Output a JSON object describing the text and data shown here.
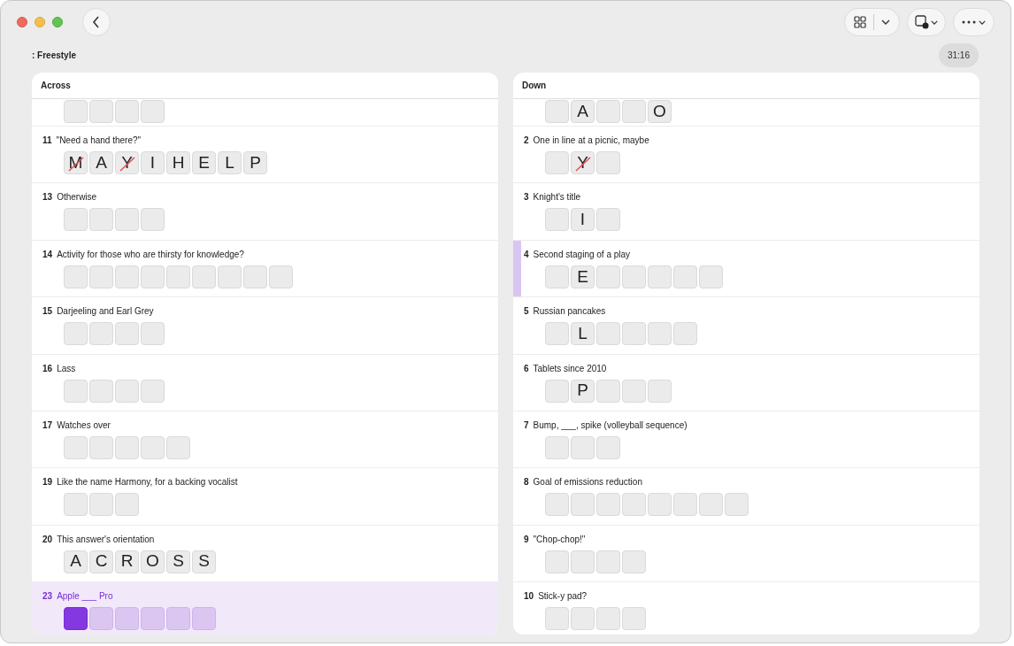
{
  "title": ": Freestyle",
  "timer": "31:16",
  "panels": [
    {
      "heading": "Across",
      "clues": [
        {
          "kind": "partial",
          "active": false,
          "related": false,
          "cells": [
            {
              "selected": false
            },
            {
              "selected": false
            },
            {
              "selected": false
            },
            {
              "selected": false
            }
          ]
        },
        {
          "kind": "full",
          "number": "11",
          "text": "\"Need a hand there?\"",
          "active": false,
          "related": false,
          "cells": [
            {
              "letter": "M",
              "wrong": true,
              "selected": false
            },
            {
              "letter": "A",
              "selected": false
            },
            {
              "letter": "Y",
              "wrong": true,
              "selected": false
            },
            {
              "letter": "I",
              "selected": false
            },
            {
              "letter": "H",
              "selected": false
            },
            {
              "letter": "E",
              "selected": false
            },
            {
              "letter": "L",
              "selected": false
            },
            {
              "letter": "P",
              "selected": false
            }
          ]
        },
        {
          "kind": "full",
          "number": "13",
          "text": "Otherwise",
          "active": false,
          "related": false,
          "cells": [
            {
              "selected": false
            },
            {
              "selected": false
            },
            {
              "selected": false
            },
            {
              "selected": false
            }
          ]
        },
        {
          "kind": "full",
          "number": "14",
          "text": "Activity for those who are thirsty for knowledge?",
          "active": false,
          "related": false,
          "cells": [
            {
              "selected": false
            },
            {
              "selected": false
            },
            {
              "selected": false
            },
            {
              "selected": false
            },
            {
              "selected": false
            },
            {
              "selected": false
            },
            {
              "selected": false
            },
            {
              "selected": false
            },
            {
              "selected": false
            }
          ]
        },
        {
          "kind": "full",
          "number": "15",
          "text": "Darjeeling and Earl Grey",
          "active": false,
          "related": false,
          "cells": [
            {
              "selected": false
            },
            {
              "selected": false
            },
            {
              "selected": false
            },
            {
              "selected": false
            }
          ]
        },
        {
          "kind": "full",
          "number": "16",
          "text": "Lass",
          "active": false,
          "related": false,
          "cells": [
            {
              "selected": false
            },
            {
              "selected": false
            },
            {
              "selected": false
            },
            {
              "selected": false
            }
          ]
        },
        {
          "kind": "full",
          "number": "17",
          "text": "Watches over",
          "active": false,
          "related": false,
          "cells": [
            {
              "selected": false
            },
            {
              "selected": false
            },
            {
              "selected": false
            },
            {
              "selected": false
            },
            {
              "selected": false
            }
          ]
        },
        {
          "kind": "full",
          "number": "19",
          "text": "Like the name Harmony, for a backing vocalist",
          "active": false,
          "related": false,
          "cells": [
            {
              "selected": false
            },
            {
              "selected": false
            },
            {
              "selected": false
            }
          ]
        },
        {
          "kind": "full",
          "number": "20",
          "text": "This answer's orientation",
          "active": false,
          "related": false,
          "cells": [
            {
              "letter": "A",
              "selected": false
            },
            {
              "letter": "C",
              "selected": false
            },
            {
              "letter": "R",
              "selected": false
            },
            {
              "letter": "O",
              "selected": false
            },
            {
              "letter": "S",
              "selected": false
            },
            {
              "letter": "S",
              "selected": false
            }
          ]
        },
        {
          "kind": "full",
          "number": "23",
          "text": "Apple ___ Pro",
          "active": true,
          "related": false,
          "cells": [
            {
              "selected": true
            },
            {
              "selected": false
            },
            {
              "selected": false
            },
            {
              "selected": false
            },
            {
              "selected": false
            },
            {
              "selected": false
            }
          ]
        }
      ]
    },
    {
      "heading": "Down",
      "clues": [
        {
          "kind": "partial",
          "active": false,
          "related": false,
          "cells": [
            {
              "selected": false
            },
            {
              "letter": "A",
              "selected": false
            },
            {
              "selected": false
            },
            {
              "selected": false
            },
            {
              "letter": "O",
              "selected": false
            }
          ]
        },
        {
          "kind": "full",
          "number": "2",
          "text": "One in line at a picnic, maybe",
          "active": false,
          "related": false,
          "cells": [
            {
              "selected": false
            },
            {
              "letter": "Y",
              "wrong": true,
              "selected": false
            },
            {
              "selected": false
            }
          ]
        },
        {
          "kind": "full",
          "number": "3",
          "text": "Knight's title",
          "active": false,
          "related": false,
          "cells": [
            {
              "selected": false
            },
            {
              "letter": "I",
              "selected": false
            },
            {
              "selected": false
            }
          ]
        },
        {
          "kind": "full",
          "number": "4",
          "text": "Second staging of a play",
          "active": false,
          "related": true,
          "cells": [
            {
              "selected": false
            },
            {
              "letter": "E",
              "selected": false
            },
            {
              "selected": false
            },
            {
              "selected": false
            },
            {
              "selected": false
            },
            {
              "selected": false
            },
            {
              "selected": false
            }
          ]
        },
        {
          "kind": "full",
          "number": "5",
          "text": "Russian pancakes",
          "active": false,
          "related": false,
          "cells": [
            {
              "selected": false
            },
            {
              "letter": "L",
              "selected": false
            },
            {
              "selected": false
            },
            {
              "selected": false
            },
            {
              "selected": false
            },
            {
              "selected": false
            }
          ]
        },
        {
          "kind": "full",
          "number": "6",
          "text": "Tablets since 2010",
          "active": false,
          "related": false,
          "cells": [
            {
              "selected": false
            },
            {
              "letter": "P",
              "selected": false
            },
            {
              "selected": false
            },
            {
              "selected": false
            },
            {
              "selected": false
            }
          ]
        },
        {
          "kind": "full",
          "number": "7",
          "text": "Bump, ___, spike (volleyball sequence)",
          "active": false,
          "related": false,
          "cells": [
            {
              "selected": false
            },
            {
              "selected": false
            },
            {
              "selected": false
            }
          ]
        },
        {
          "kind": "full",
          "number": "8",
          "text": "Goal of emissions reduction",
          "active": false,
          "related": false,
          "cells": [
            {
              "selected": false
            },
            {
              "selected": false
            },
            {
              "selected": false
            },
            {
              "selected": false
            },
            {
              "selected": false
            },
            {
              "selected": false
            },
            {
              "selected": false
            },
            {
              "selected": false
            }
          ]
        },
        {
          "kind": "full",
          "number": "9",
          "text": "\"Chop-chop!\"",
          "active": false,
          "related": false,
          "cells": [
            {
              "selected": false
            },
            {
              "selected": false
            },
            {
              "selected": false
            },
            {
              "selected": false
            }
          ]
        },
        {
          "kind": "full",
          "number": "10",
          "text": "Stick-y pad?",
          "active": false,
          "related": false,
          "cells": [
            {
              "selected": false
            },
            {
              "selected": false
            },
            {
              "selected": false
            },
            {
              "selected": false
            }
          ]
        }
      ]
    }
  ]
}
